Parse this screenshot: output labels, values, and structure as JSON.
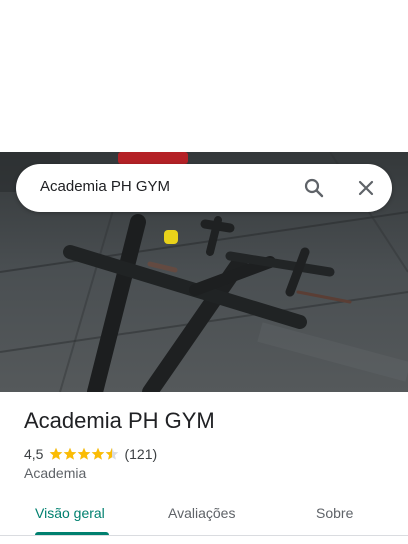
{
  "search": {
    "query": "Academia PH GYM"
  },
  "place": {
    "name": "Academia PH GYM",
    "rating": "4,5",
    "rating_stars": 4.5,
    "review_count": "(121)",
    "category": "Academia"
  },
  "tabs": [
    {
      "label": "Visão geral",
      "selected": true
    },
    {
      "label": "Avaliações",
      "selected": false
    },
    {
      "label": "Sobre",
      "selected": false
    }
  ],
  "icons": {
    "search": "search-icon",
    "close": "close-icon",
    "star": "star-icon"
  },
  "colors": {
    "accent": "#00806f",
    "star": "#fbbc04",
    "text_primary": "#202124",
    "text_secondary": "#5f6368"
  }
}
